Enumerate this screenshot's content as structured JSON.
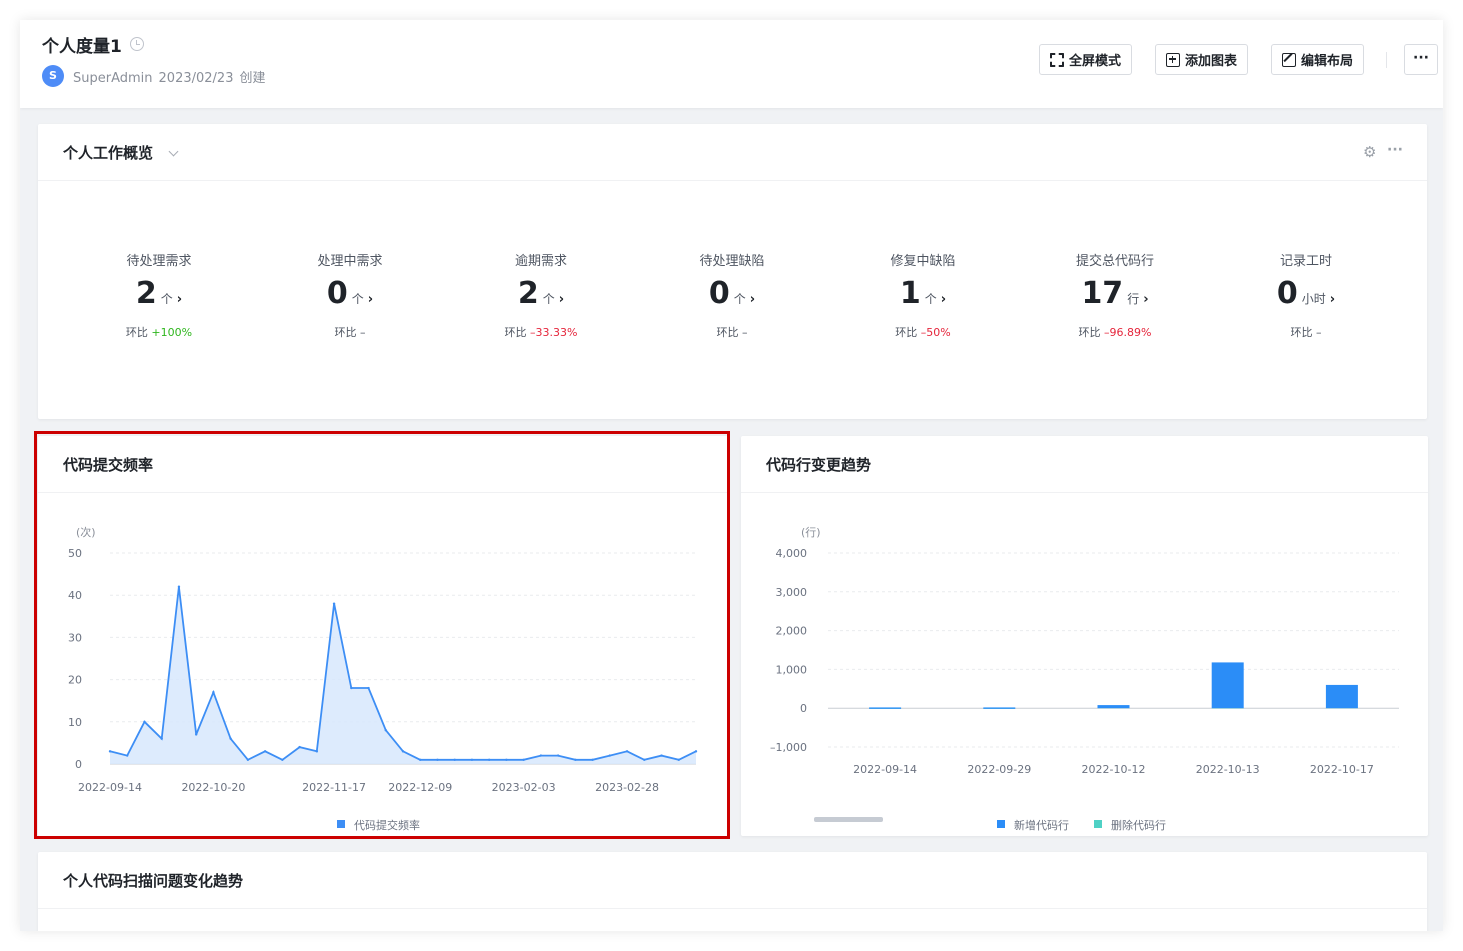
{
  "header": {
    "title": "个人度量1",
    "avatar_letter": "S",
    "creator": "SuperAdmin",
    "created_date": "2023/02/23",
    "created_suffix": "创建",
    "buttons": {
      "fullscreen": "全屏模式",
      "add_chart": "添加图表",
      "edit_layout": "编辑布局",
      "more": "···"
    }
  },
  "overview": {
    "title": "个人工作概览",
    "more": "···",
    "compare_label": "环比",
    "stats": [
      {
        "label": "待处理需求",
        "value": "2",
        "unit": "个",
        "change": "+100%",
        "tone": "pos"
      },
      {
        "label": "处理中需求",
        "value": "0",
        "unit": "个",
        "change": "–",
        "tone": "neu"
      },
      {
        "label": "逾期需求",
        "value": "2",
        "unit": "个",
        "change": "–33.33%",
        "tone": "neg"
      },
      {
        "label": "待处理缺陷",
        "value": "0",
        "unit": "个",
        "change": "–",
        "tone": "neu"
      },
      {
        "label": "修复中缺陷",
        "value": "1",
        "unit": "个",
        "change": "–50%",
        "tone": "neg"
      },
      {
        "label": "提交总代码行",
        "value": "17",
        "unit": "行",
        "change": "–96.89%",
        "tone": "neg"
      },
      {
        "label": "记录工时",
        "value": "0",
        "unit": "小时",
        "change": "–",
        "tone": "neu"
      }
    ]
  },
  "scan_card": {
    "title": "个人代码扫描问题变化趋势"
  },
  "chart_data": [
    {
      "title": "代码提交频率",
      "type": "area",
      "y_unit": "(次)",
      "ylim": [
        0,
        50
      ],
      "y_ticks": [
        0,
        10,
        20,
        30,
        40,
        50
      ],
      "x_tick_labels": [
        "2022-09-14",
        "2022-10-20",
        "2022-11-17",
        "2022-12-09",
        "2023-02-03",
        "2023-02-28"
      ],
      "legend": "代码提交频率",
      "color": "#3d8ef5",
      "values": [
        3,
        2,
        10,
        6,
        42,
        7,
        17,
        6,
        1,
        3,
        1,
        4,
        3,
        38,
        18,
        18,
        8,
        3,
        1,
        1,
        1,
        1,
        1,
        1,
        1,
        2,
        2,
        1,
        1,
        2,
        3,
        1,
        2,
        1,
        3
      ]
    },
    {
      "title": "代码行变更趋势",
      "type": "bar",
      "y_unit": "(行)",
      "ylim": [
        -1000,
        4000
      ],
      "y_tick_labels": [
        "4,000",
        "3,000",
        "2,000",
        "1,000",
        "0",
        "–1,000"
      ],
      "y_ticks": [
        4000,
        3000,
        2000,
        1000,
        0,
        -1000
      ],
      "categories": [
        "2022-09-14",
        "2022-09-29",
        "2022-10-12",
        "2022-10-13",
        "2022-10-17"
      ],
      "series": [
        {
          "name": "新增代码行",
          "color": "#2b8df7",
          "values": [
            20,
            20,
            80,
            1180,
            600
          ]
        },
        {
          "name": "删除代码行",
          "color": "#4fd1c5",
          "values": [
            5,
            5,
            10,
            30,
            20
          ]
        }
      ]
    }
  ]
}
